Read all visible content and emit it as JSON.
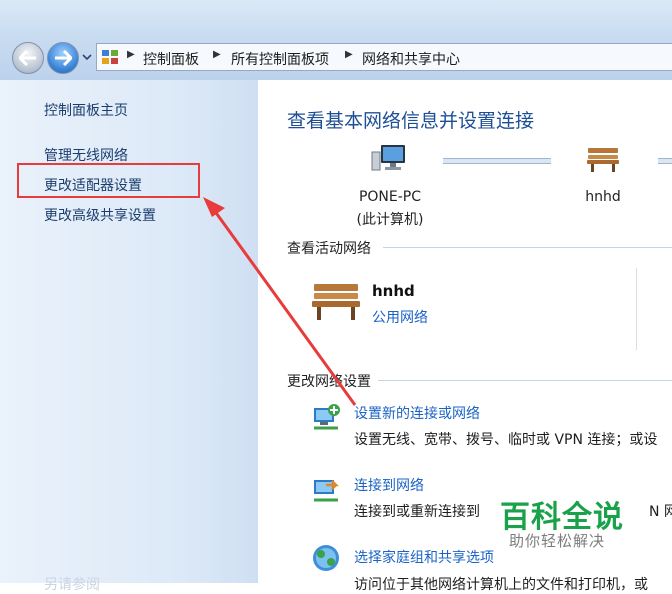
{
  "address_bar": {
    "crumbs": [
      "控制面板",
      "所有控制面板项",
      "网络和共享中心"
    ]
  },
  "sidebar": {
    "items": [
      {
        "label": "控制面板主页"
      },
      {
        "label": "管理无线网络"
      },
      {
        "label": "更改适配器设置"
      },
      {
        "label": "更改高级共享设置"
      }
    ],
    "see_also": "另请参阅"
  },
  "main": {
    "title": "查看基本网络信息并设置连接",
    "map": {
      "computer_name": "PONE-PC",
      "computer_sub": "(此计算机)",
      "network_name": "hnhd"
    },
    "active_section": "查看活动网络",
    "active_network": {
      "name": "hnhd",
      "type": "公用网络"
    },
    "change_section": "更改网络设置",
    "tasks": [
      {
        "label": "设置新的连接或网络",
        "desc": "设置无线、宽带、拨号、临时或 VPN 连接；或设",
        "icon": "new-connection-icon"
      },
      {
        "label": "连接到网络",
        "desc": "连接到或重新连接到",
        "desc_tail": "N 网",
        "icon": "connect-network-icon"
      },
      {
        "label": "选择家庭组和共享选项",
        "desc": "访问位于其他网络计算机上的文件和打印机，或",
        "icon": "homegroup-icon"
      }
    ]
  },
  "annotation": {
    "color": "#e83b3b"
  },
  "watermark": {
    "title": "百科全说",
    "subtitle": "助你轻松解决"
  }
}
